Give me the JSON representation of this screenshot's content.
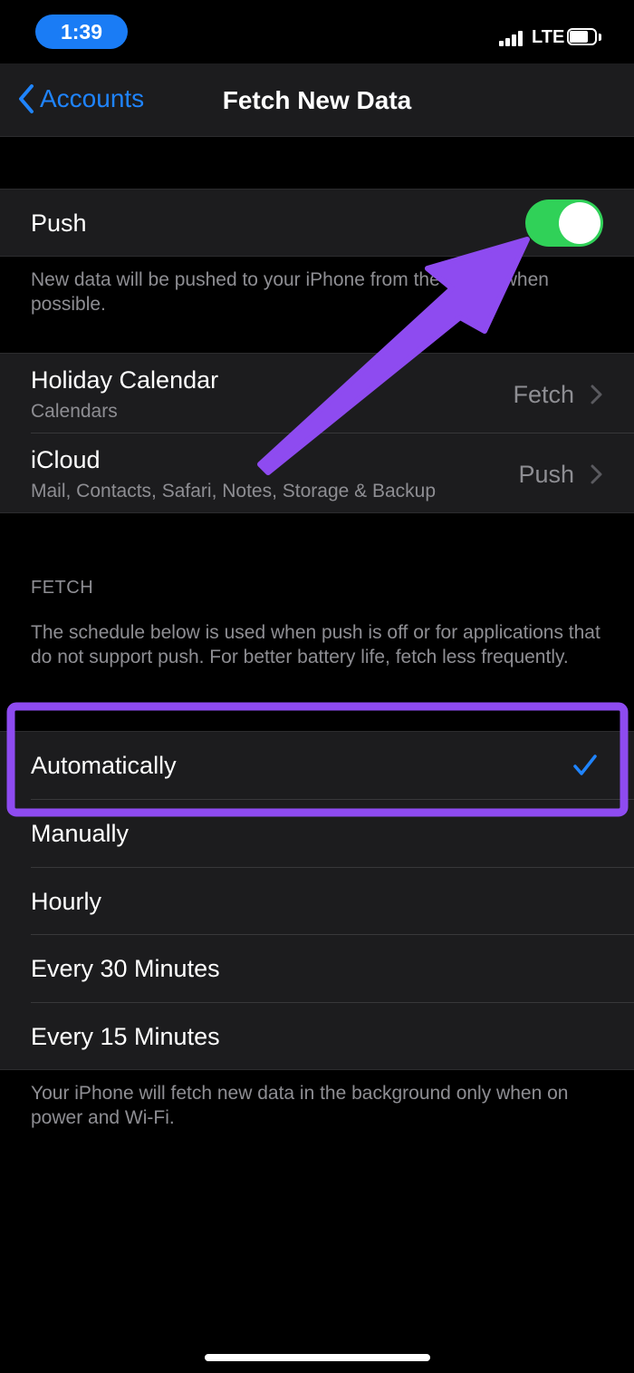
{
  "status": {
    "time": "1:39",
    "network": "LTE"
  },
  "nav": {
    "back_label": "Accounts",
    "title": "Fetch New Data"
  },
  "push": {
    "label": "Push",
    "enabled": true,
    "footnote": "New data will be pushed to your iPhone from the server when possible."
  },
  "accounts": [
    {
      "name": "Holiday Calendar",
      "detail": "Calendars",
      "mode": "Fetch"
    },
    {
      "name": "iCloud",
      "detail": "Mail, Contacts, Safari, Notes, Storage & Backup",
      "mode": "Push"
    }
  ],
  "fetch": {
    "header": "FETCH",
    "description": "The schedule below is used when push is off or for applications that do not support push. For better battery life, fetch less frequently.",
    "options": [
      "Automatically",
      "Manually",
      "Hourly",
      "Every 30 Minutes",
      "Every 15 Minutes"
    ],
    "selected": "Automatically",
    "footnote": "Your iPhone will fetch new data in the background only when on power and Wi-Fi."
  },
  "annotation": {
    "color": "#8e4bf0"
  },
  "colors": {
    "accent": "#1f84ff",
    "toggle_on": "#30d158",
    "cell_bg": "#1c1c1e"
  }
}
